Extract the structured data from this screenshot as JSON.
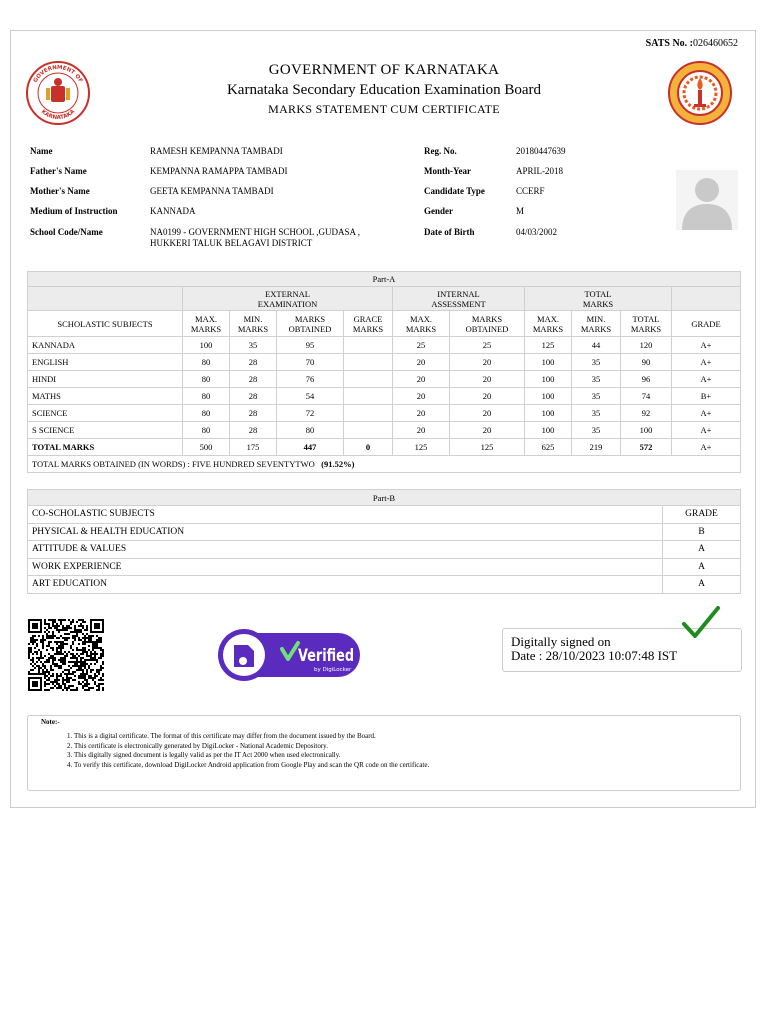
{
  "sats": {
    "label": "SATS No. :",
    "value": "026460652"
  },
  "header": {
    "title": "GOVERNMENT OF KARNATAKA",
    "board": "Karnataka Secondary Education Examination Board",
    "subtitle": "MARKS STATEMENT CUM CERTIFICATE"
  },
  "seal_left": {
    "top": "GOVERNMENT OF",
    "bottom": "KARNATAKA"
  },
  "student": {
    "name_label": "Name",
    "name": "RAMESH KEMPANNA TAMBADI",
    "father_label": "Father's Name",
    "father": "KEMPANNA RAMAPPA TAMBADI",
    "mother_label": "Mother's Name",
    "mother": "GEETA KEMPANNA TAMBADI",
    "medium_label": "Medium of Instruction",
    "medium": "KANNADA",
    "school_label": "School Code/Name",
    "school_line1": "NA0199 - GOVERNMENT HIGH SCHOOL ,GUDASA ,",
    "school_line2": "HUKKERI TALUK BELAGAVI DISTRICT",
    "reg_label": "Reg. No.",
    "reg": "20180447639",
    "month_label": "Month-Year",
    "month": "APRIL-2018",
    "type_label": "Candidate Type",
    "type": "CCERF",
    "gender_label": "Gender",
    "gender": "M",
    "dob_label": "Date of Birth",
    "dob": "04/03/2002"
  },
  "partA": {
    "title": "Part-A",
    "ext_head": [
      "EXTERNAL",
      "EXAMINATION"
    ],
    "int_head": [
      "INTERNAL",
      "ASSESSMENT"
    ],
    "tot_head": [
      "TOTAL",
      "MARKS"
    ],
    "col_subjects": "SCHOLASTIC SUBJECTS",
    "cols": [
      [
        "MAX.",
        "MARKS"
      ],
      [
        "MIN.",
        "MARKS"
      ],
      [
        "MARKS",
        "OBTAINED"
      ],
      [
        "GRACE",
        "MARKS"
      ],
      [
        "MAX.",
        "MARKS"
      ],
      [
        "MARKS",
        "OBTAINED"
      ],
      [
        "MAX.",
        "MARKS"
      ],
      [
        "MIN.",
        "MARKS"
      ],
      [
        "TOTAL",
        "MARKS"
      ]
    ],
    "col_grade": "GRADE",
    "rows": [
      [
        "KANNADA",
        "100",
        "35",
        "95",
        "",
        "25",
        "25",
        "125",
        "44",
        "120",
        "A+"
      ],
      [
        "ENGLISH",
        "80",
        "28",
        "70",
        "",
        "20",
        "20",
        "100",
        "35",
        "90",
        "A+"
      ],
      [
        "HINDI",
        "80",
        "28",
        "76",
        "",
        "20",
        "20",
        "100",
        "35",
        "96",
        "A+"
      ],
      [
        "MATHS",
        "80",
        "28",
        "54",
        "",
        "20",
        "20",
        "100",
        "35",
        "74",
        "B+"
      ],
      [
        "SCIENCE",
        "80",
        "28",
        "72",
        "",
        "20",
        "20",
        "100",
        "35",
        "92",
        "A+"
      ],
      [
        "S SCIENCE",
        "80",
        "28",
        "80",
        "",
        "20",
        "20",
        "100",
        "35",
        "100",
        "A+"
      ]
    ],
    "total": [
      "TOTAL MARKS",
      "500",
      "175",
      "447",
      "0",
      "125",
      "125",
      "625",
      "219",
      "572",
      "A+"
    ],
    "words": "TOTAL MARKS OBTAINED (IN WORDS) : FIVE HUNDRED SEVENTYTWO",
    "percent": "(91.52%)"
  },
  "partB": {
    "title": "Part-B",
    "col_subjects": "CO-SCHOLASTIC SUBJECTS",
    "col_grade": "GRADE",
    "rows": [
      [
        "PHYSICAL & HEALTH EDUCATION",
        "B"
      ],
      [
        "ATTITUDE & VALUES",
        "A"
      ],
      [
        "WORK EXPERIENCE",
        "A"
      ],
      [
        "ART EDUCATION",
        "A"
      ]
    ]
  },
  "badge": {
    "verified": "Verified",
    "by": "by DigiLocker"
  },
  "signature": {
    "line1": "Digitally signed on",
    "line2": "Date : 28/10/2023 10:07:48 IST"
  },
  "notes": {
    "title": "Note:-",
    "items": [
      "This is a digital certificate. The format of this certificate may differ from the document issued by the Board.",
      "This certificate is electronically generated by DigiLocker - National Academic Depository.",
      "This digitally signed document is legally valid as per the IT Act 2000 when used electronically.",
      "To verify this certificate, download DigiLocker Android application from Google Play and scan the QR code on the certificate."
    ]
  },
  "colors": {
    "badge": "#5b2bbf",
    "tick": "#1e8c1e",
    "seal_red": "#c8302a",
    "seal_orange": "#e85b1e"
  }
}
